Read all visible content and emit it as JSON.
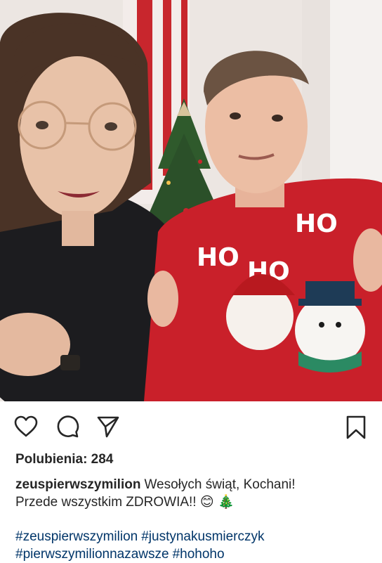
{
  "post": {
    "photo_alt": "",
    "sweater_text": [
      "HO",
      "HO",
      "HO"
    ],
    "likes_text": "Polubienia: 284",
    "username": "zeuspierwszymilion",
    "caption_line1": "Wesołych świąt, Kochani!",
    "caption_line2": "Przede wszystkim ZDROWIA!!",
    "emoji_smile": "😊",
    "emoji_tree": "🎄",
    "hashtags": [
      "#zeuspierwszymilion",
      "#justynakusmierczyk",
      "#pierwszymilionnazawsze",
      "#hohoho"
    ]
  },
  "icons": {
    "like": "heart-outline-icon",
    "comment": "comment-bubble-icon",
    "share": "paper-plane-icon",
    "save": "bookmark-outline-icon"
  },
  "colors": {
    "sweater_red": "#c9202a",
    "hashtag_blue": "#003569",
    "text": "#262626"
  }
}
